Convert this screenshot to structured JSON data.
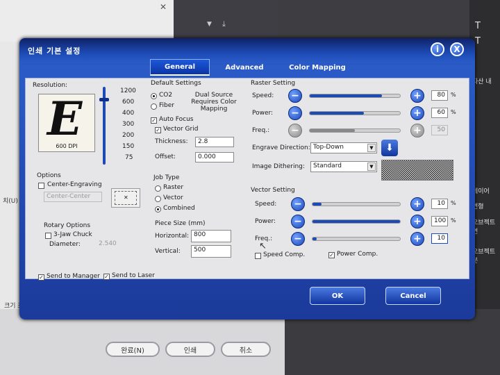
{
  "background": {
    "bottom_buttons": [
      "완료(N)",
      "인쇄",
      "취소"
    ],
    "left_text": [
      "크기 조정",
      "치(U)"
    ],
    "right_text": [
      "자산 내",
      "레이어",
      "변형",
      "오브젝트 변",
      "오브젝트 분"
    ],
    "dark_strip_icon": "download-icon"
  },
  "dialog": {
    "title": "인쇄 기본 설정",
    "help_label": "i",
    "close_label": "X",
    "tabs": [
      "General",
      "Advanced",
      "Color Mapping"
    ],
    "active_tab": "General",
    "resolution": {
      "label": "Resolution:",
      "preview_letter": "E",
      "dpi_label": "600 DPI",
      "levels": [
        "1200",
        "600",
        "400",
        "300",
        "200",
        "150",
        "75"
      ]
    },
    "options": {
      "label": "Options",
      "center_engraving": {
        "label": "Center-Engraving",
        "checked": false
      },
      "center_position_value": "Center-Center"
    },
    "rotary": {
      "label": "Rotary Options",
      "chuck": {
        "label": "3-Jaw Chuck",
        "checked": false
      },
      "diameter_label": "Diameter:",
      "diameter_value": "2.540"
    },
    "send_to_manager": {
      "label": "Send to Manager",
      "checked": true
    },
    "send_to_laser": {
      "label": "Send to Laser",
      "checked": true
    },
    "default_settings": {
      "label": "Default Settings",
      "source_co2": "CO2",
      "source_fiber": "Fiber",
      "dual_source_note": "Dual Source Requires Color Mapping",
      "auto_focus": {
        "label": "Auto Focus",
        "checked": true
      },
      "vector_grid": {
        "label": "Vector Grid",
        "checked": true
      },
      "thickness_label": "Thickness:",
      "thickness_value": "2.8",
      "offset_label": "Offset:",
      "offset_value": "0.000"
    },
    "job_type": {
      "label": "Job Type",
      "options": [
        "Raster",
        "Vector",
        "Combined"
      ],
      "selected": "Combined"
    },
    "piece_size": {
      "label": "Piece Size (mm)",
      "horizontal_label": "Horizontal:",
      "horizontal_value": "800",
      "vertical_label": "Vertical:",
      "vertical_value": "500"
    },
    "raster": {
      "label": "Raster Setting",
      "speed": {
        "label": "Speed:",
        "value": "80",
        "unit": "%",
        "level": 0.8
      },
      "power": {
        "label": "Power:",
        "value": "60",
        "unit": "%",
        "level": 0.6
      },
      "freq": {
        "label": "Freq.:",
        "value": "50",
        "level": 0.5
      },
      "engrave_direction_label": "Engrave Direction:",
      "engrave_direction_value": "Top-Down",
      "image_dithering_label": "Image Dithering:",
      "image_dithering_value": "Standard"
    },
    "vector": {
      "label": "Vector Setting",
      "speed": {
        "label": "Speed:",
        "value": "10",
        "unit": "%",
        "level": 0.1
      },
      "power": {
        "label": "Power:",
        "value": "100",
        "unit": "%",
        "level": 1.0
      },
      "freq": {
        "label": "Freq.:",
        "value": "10",
        "level": 0.05
      },
      "speed_comp": {
        "label": "Speed Comp.",
        "checked": false
      },
      "power_comp": {
        "label": "Power Comp.",
        "checked": true
      }
    },
    "ok_label": "OK",
    "cancel_label": "Cancel"
  }
}
